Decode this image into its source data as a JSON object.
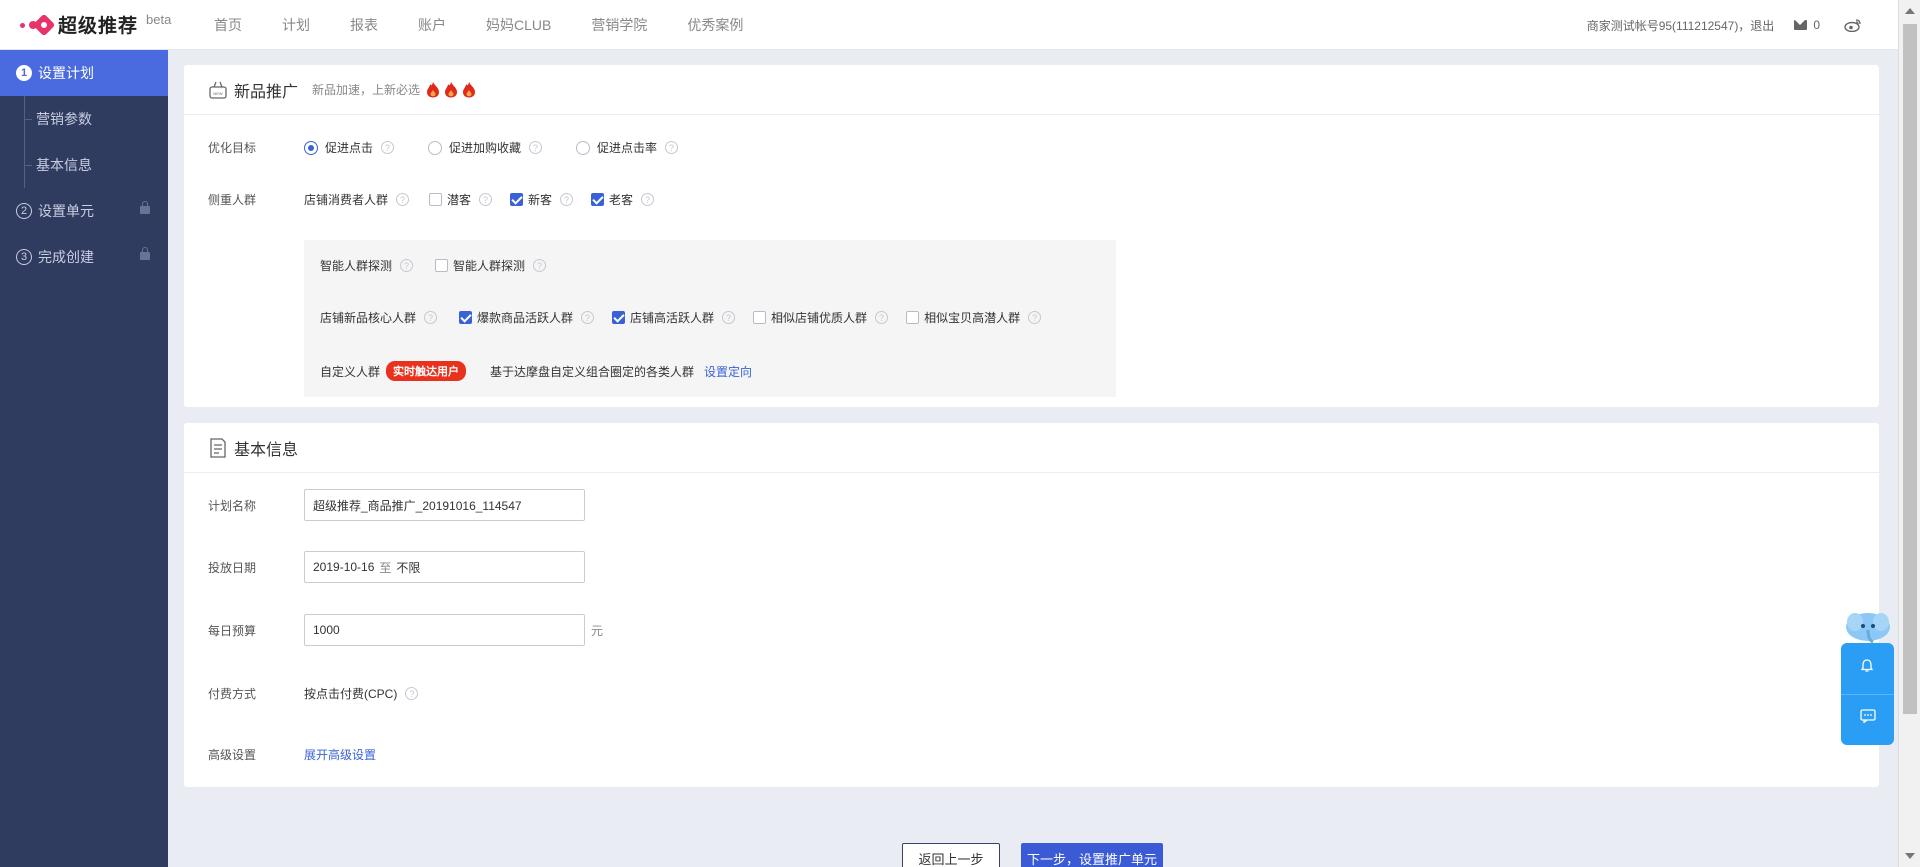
{
  "header": {
    "logo_text": "超级推荐",
    "logo_badge": "beta",
    "nav": [
      "首页",
      "计划",
      "报表",
      "账户",
      "妈妈CLUB",
      "营销学院",
      "优秀案例"
    ],
    "account_text": "商家测试帐号95(111212547)，退出",
    "mail_count": "0"
  },
  "sidebar": {
    "steps": [
      {
        "num": "1",
        "label": "设置计划",
        "active": true
      },
      {
        "num": "2",
        "label": "设置单元",
        "locked": true
      },
      {
        "num": "3",
        "label": "完成创建",
        "locked": true
      }
    ],
    "substeps": [
      "营销参数",
      "基本信息"
    ]
  },
  "promo_card": {
    "title": "新品推广",
    "subtitle": "新品加速，上新必选",
    "goal_label": "优化目标",
    "goals": [
      "促进点击",
      "促进加购收藏",
      "促进点击率"
    ],
    "goal_selected": "促进点击",
    "crowd_label": "侧重人群",
    "store_crowd_label": "店铺消费者人群",
    "store_crowd_options": [
      {
        "label": "潜客",
        "checked": false
      },
      {
        "label": "新客",
        "checked": true
      },
      {
        "label": "老客",
        "checked": true
      }
    ],
    "smart_label": "智能人群探测",
    "smart_option": {
      "label": "智能人群探测",
      "checked": false
    },
    "core_label": "店铺新品核心人群",
    "core_options": [
      {
        "label": "爆款商品活跃人群",
        "checked": true
      },
      {
        "label": "店铺高活跃人群",
        "checked": true
      },
      {
        "label": "相似店铺优质人群",
        "checked": false
      },
      {
        "label": "相似宝贝高潜人群",
        "checked": false
      }
    ],
    "custom_label": "自定义人群",
    "custom_tag": "实时触达用户",
    "custom_desc": "基于达摩盘自定义组合圈定的各类人群",
    "custom_link": "设置定向"
  },
  "basic_card": {
    "title": "基本信息",
    "plan_name_label": "计划名称",
    "plan_name_value": "超级推荐_商品推广_20191016_114547",
    "date_label": "投放日期",
    "date_start": "2019-10-16",
    "date_sep": "至",
    "date_end": "不限",
    "budget_label": "每日预算",
    "budget_value": "1000",
    "budget_unit": "元",
    "pay_label": "付费方式",
    "pay_value": "按点击付费(CPC)",
    "advanced_label": "高级设置",
    "advanced_link": "展开高级设置"
  },
  "footer": {
    "prev_label": "返回上一步",
    "next_label": "下一步，设置推广单元"
  },
  "colors": {
    "sidebar_bg": "#303b60",
    "active_step": "#4a6be0",
    "primary": "#3a62d7",
    "brand": "#e8336a",
    "tag_red": "#e8321e",
    "float_widget": "#2a9ef4"
  }
}
